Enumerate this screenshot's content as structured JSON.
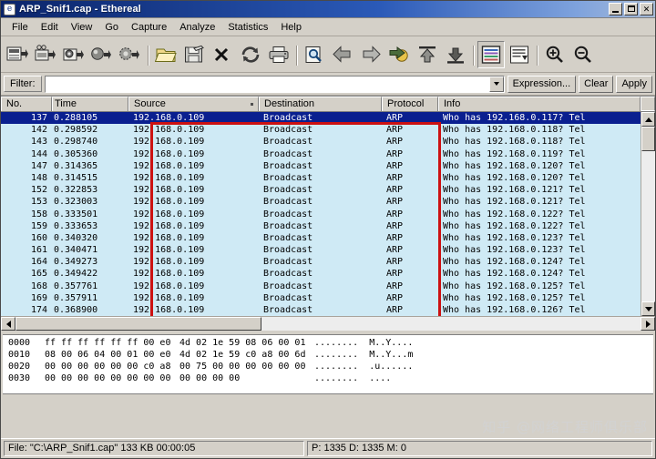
{
  "window": {
    "title": "ARP_Snif1.cap - Ethereal",
    "icon": "ethereal-icon",
    "minimize_label": "",
    "maximize_label": "",
    "close_label": "✕"
  },
  "menu": {
    "items": [
      {
        "label": "File"
      },
      {
        "label": "Edit"
      },
      {
        "label": "View"
      },
      {
        "label": "Go"
      },
      {
        "label": "Capture"
      },
      {
        "label": "Analyze"
      },
      {
        "label": "Statistics"
      },
      {
        "label": "Help"
      }
    ]
  },
  "toolbar": {
    "buttons": [
      {
        "name": "list-interfaces-icon",
        "title": "List available capture interfaces"
      },
      {
        "name": "capture-options-icon",
        "title": "Show capture options"
      },
      {
        "name": "start-capture-icon",
        "title": "Start a new live capture"
      },
      {
        "name": "stop-capture-icon",
        "title": "Stop the running live capture"
      },
      {
        "name": "restart-capture-icon",
        "title": "Restart the running live capture"
      },
      {
        "name": "open-file-icon",
        "title": "Open a capture file"
      },
      {
        "name": "save-file-icon",
        "title": "Save this capture file"
      },
      {
        "name": "close-file-icon",
        "title": "Close this capture file"
      },
      {
        "name": "reload-file-icon",
        "title": "Reload this capture file"
      },
      {
        "name": "print-icon",
        "title": "Print packet"
      },
      {
        "name": "find-packet-icon",
        "title": "Find a packet"
      },
      {
        "name": "go-back-icon",
        "title": "Go back in packet history"
      },
      {
        "name": "go-forward-icon",
        "title": "Go forward in packet history"
      },
      {
        "name": "go-to-packet-icon",
        "title": "Go to the packet with number"
      },
      {
        "name": "go-to-first-icon",
        "title": "Go to the first packet"
      },
      {
        "name": "go-to-last-icon",
        "title": "Go to the last packet"
      },
      {
        "name": "colorize-icon",
        "title": "Colorize packet list"
      },
      {
        "name": "auto-scroll-icon",
        "title": "Auto scroll in live capture"
      },
      {
        "name": "zoom-in-icon",
        "title": "Zoom in"
      },
      {
        "name": "zoom-out-icon",
        "title": "Zoom out"
      }
    ]
  },
  "filter": {
    "label": "Filter:",
    "value": "",
    "placeholder": "",
    "dropdown_icon": "chevron-down-icon",
    "expression_label": "Expression...",
    "clear_label": "Clear",
    "apply_label": "Apply"
  },
  "packet_list": {
    "columns": [
      {
        "key": "no",
        "label": "No."
      },
      {
        "key": "time",
        "label": "Time"
      },
      {
        "key": "source",
        "label": "Source",
        "sorted": true
      },
      {
        "key": "destination",
        "label": "Destination"
      },
      {
        "key": "protocol",
        "label": "Protocol"
      },
      {
        "key": "info",
        "label": "Info"
      }
    ],
    "rows": [
      {
        "no": "137",
        "time": "0.288105",
        "source": "192.168.0.109",
        "destination": "Broadcast",
        "protocol": "ARP",
        "info": "Who has 192.168.0.117?  Tel",
        "selected": true
      },
      {
        "no": "142",
        "time": "0.298592",
        "source": "192.168.0.109",
        "destination": "Broadcast",
        "protocol": "ARP",
        "info": "Who has 192.168.0.118?  Tel",
        "selected": false
      },
      {
        "no": "143",
        "time": "0.298740",
        "source": "192.168.0.109",
        "destination": "Broadcast",
        "protocol": "ARP",
        "info": "Who has 192.168.0.118?  Tel",
        "selected": false
      },
      {
        "no": "144",
        "time": "0.305360",
        "source": "192.168.0.109",
        "destination": "Broadcast",
        "protocol": "ARP",
        "info": "Who has 192.168.0.119?  Tel",
        "selected": false
      },
      {
        "no": "147",
        "time": "0.314365",
        "source": "192.168.0.109",
        "destination": "Broadcast",
        "protocol": "ARP",
        "info": "Who has 192.168.0.120?  Tel",
        "selected": false
      },
      {
        "no": "148",
        "time": "0.314515",
        "source": "192.168.0.109",
        "destination": "Broadcast",
        "protocol": "ARP",
        "info": "Who has 192.168.0.120?  Tel",
        "selected": false
      },
      {
        "no": "152",
        "time": "0.322853",
        "source": "192.168.0.109",
        "destination": "Broadcast",
        "protocol": "ARP",
        "info": "Who has 192.168.0.121?  Tel",
        "selected": false
      },
      {
        "no": "153",
        "time": "0.323003",
        "source": "192.168.0.109",
        "destination": "Broadcast",
        "protocol": "ARP",
        "info": "Who has 192.168.0.121?  Tel",
        "selected": false
      },
      {
        "no": "158",
        "time": "0.333501",
        "source": "192.168.0.109",
        "destination": "Broadcast",
        "protocol": "ARP",
        "info": "Who has 192.168.0.122?  Tel",
        "selected": false
      },
      {
        "no": "159",
        "time": "0.333653",
        "source": "192.168.0.109",
        "destination": "Broadcast",
        "protocol": "ARP",
        "info": "Who has 192.168.0.122?  Tel",
        "selected": false
      },
      {
        "no": "160",
        "time": "0.340320",
        "source": "192.168.0.109",
        "destination": "Broadcast",
        "protocol": "ARP",
        "info": "Who has 192.168.0.123?  Tel",
        "selected": false
      },
      {
        "no": "161",
        "time": "0.340471",
        "source": "192.168.0.109",
        "destination": "Broadcast",
        "protocol": "ARP",
        "info": "Who has 192.168.0.123?  Tel",
        "selected": false
      },
      {
        "no": "164",
        "time": "0.349273",
        "source": "192.168.0.109",
        "destination": "Broadcast",
        "protocol": "ARP",
        "info": "Who has 192.168.0.124?  Tel",
        "selected": false
      },
      {
        "no": "165",
        "time": "0.349422",
        "source": "192.168.0.109",
        "destination": "Broadcast",
        "protocol": "ARP",
        "info": "Who has 192.168.0.124?  Tel",
        "selected": false
      },
      {
        "no": "168",
        "time": "0.357761",
        "source": "192.168.0.109",
        "destination": "Broadcast",
        "protocol": "ARP",
        "info": "Who has 192.168.0.125?  Tel",
        "selected": false
      },
      {
        "no": "169",
        "time": "0.357911",
        "source": "192.168.0.109",
        "destination": "Broadcast",
        "protocol": "ARP",
        "info": "Who has 192.168.0.125?  Tel",
        "selected": false
      },
      {
        "no": "174",
        "time": "0.368900",
        "source": "192.168.0.109",
        "destination": "Broadcast",
        "protocol": "ARP",
        "info": "Who has 192.168.0.126?  Tel",
        "selected": false
      }
    ],
    "annotation": {
      "name": "red-highlight-box",
      "color": "#cc1111"
    }
  },
  "hex_pane": {
    "lines": [
      {
        "offset": "0000",
        "bytes_left": "ff ff ff ff ff ff 00 e0",
        "bytes_right": "4d 02 1e 59 08 06 00 01",
        "ascii": "........  M..Y...."
      },
      {
        "offset": "0010",
        "bytes_left": "08 00 06 04 00 01 00 e0",
        "bytes_right": "4d 02 1e 59 c0 a8 00 6d",
        "ascii": "........  M..Y...m"
      },
      {
        "offset": "0020",
        "bytes_left": "00 00 00 00 00 00 c0 a8",
        "bytes_right": "00 75 00 00 00 00 00 00",
        "ascii": "........  .u......"
      },
      {
        "offset": "0030",
        "bytes_left": "00 00 00 00 00 00 00 00",
        "bytes_right": "00 00 00 00",
        "ascii": "........  ...."
      }
    ]
  },
  "status_bar": {
    "file_info": "File: \"C:\\ARP_Snif1.cap\" 133 KB 00:00:05",
    "counts": "P: 1335 D: 1335 M: 0"
  },
  "watermark": {
    "text": "知乎 @网络工程师俱乐部"
  }
}
